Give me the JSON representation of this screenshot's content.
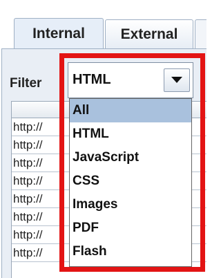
{
  "tabs": [
    {
      "label": "Internal",
      "active": true
    },
    {
      "label": "External",
      "active": false
    }
  ],
  "filter": {
    "label": "Filter",
    "selected": "HTML",
    "options": [
      "All",
      "HTML",
      "JavaScript",
      "CSS",
      "Images",
      "PDF",
      "Flash"
    ],
    "highlighted_option": "All"
  },
  "table": {
    "rows": [
      "http://",
      "http://",
      "http://",
      "http://",
      "http://",
      "http://",
      "http://",
      "http://"
    ]
  },
  "colors": {
    "highlight_border": "#e31414",
    "selected_option_bg": "#a9c1dd"
  }
}
